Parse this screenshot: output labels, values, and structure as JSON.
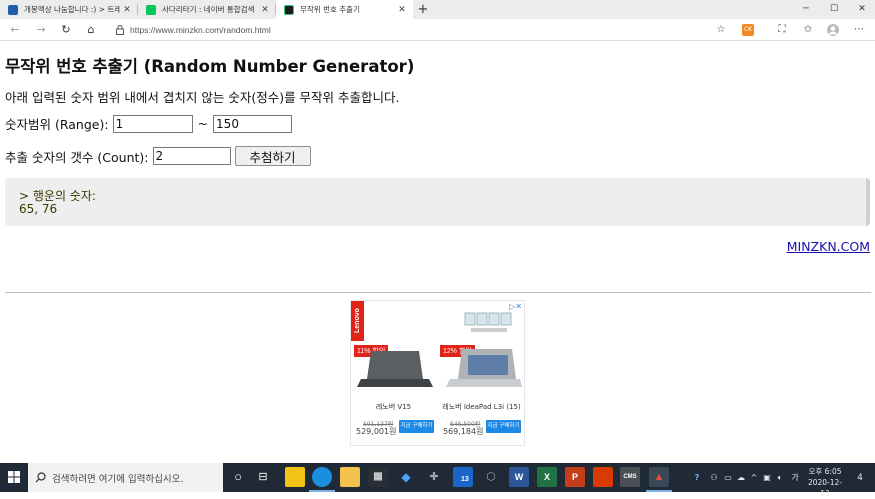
{
  "browser": {
    "tabs": [
      {
        "title": "개봉액상 나눔합니다 :) > 트레이...",
        "active": false
      },
      {
        "title": "사다리타기 : 네이버 통합검색",
        "active": false
      },
      {
        "title": "무작위 번호 추출기",
        "active": true
      }
    ],
    "new_tab_glyph": "+",
    "url": "https://www.minzkn.com/random.html",
    "extension_badge": "CK"
  },
  "page": {
    "heading": "무작위 번호 추출기 (Random Number Generator)",
    "description": "아래 입력된 숫자 범위 내에서 겹치지 않는 숫자(정수)를 무작위 추출합니다.",
    "range_label": "숫자범위 (Range):",
    "range_from": "1",
    "range_separator": "~",
    "range_to": "150",
    "count_label": "추출 숫자의 갯수 (Count):",
    "count_value": "2",
    "draw_button": "추첨하기",
    "result_label": "> 행운의 숫자:",
    "result_numbers": "65, 76",
    "site_link": "MINZKN.COM"
  },
  "ad": {
    "brand": "Lenovo",
    "products": [
      {
        "badge": "11% 할인",
        "name": "레노버 V15",
        "old_price": "591,137원",
        "price": "529,001원",
        "cta": "지금 구매하기"
      },
      {
        "badge": "12% 할인",
        "name": "레노버 IdeaPad L3i (15)",
        "old_price": "646,500원",
        "price": "569,184원",
        "cta": "지금 구매하기"
      }
    ]
  },
  "taskbar": {
    "search_placeholder": "검색하려면 여기에 입력하십시오.",
    "mail_badge": "13",
    "clock_time": "오후 6:05",
    "clock_date": "2020-12-13",
    "notification_count": "4"
  },
  "colors": {
    "link": "#1a0dab",
    "result_bg": "#eeeeee",
    "result_text": "#3a3a00",
    "taskbar_bg": "#1f2a36",
    "ad_red": "#e2231a",
    "ad_button": "#1e88e5"
  }
}
